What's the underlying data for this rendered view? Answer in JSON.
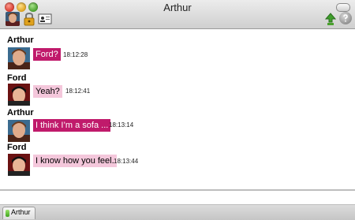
{
  "window": {
    "title": "Arthur"
  },
  "messages": [
    {
      "sender": "Arthur",
      "text": "Ford?",
      "time": "18:12:28",
      "style": "arthur"
    },
    {
      "sender": "Ford",
      "text": "Yeah?",
      "time": "18:12:41",
      "style": "ford"
    },
    {
      "sender": "Arthur",
      "text": "I think I’m a sofa ...",
      "time": "18:13:14",
      "style": "arthur"
    },
    {
      "sender": "Ford",
      "text": "I know how you feel.",
      "time": "18:13:44",
      "style": "ford"
    }
  ],
  "tabs": [
    {
      "label": "Arthur"
    }
  ],
  "colors": {
    "arthur_bubble": "#c01a6b",
    "ford_bubble": "#f4c7db"
  }
}
